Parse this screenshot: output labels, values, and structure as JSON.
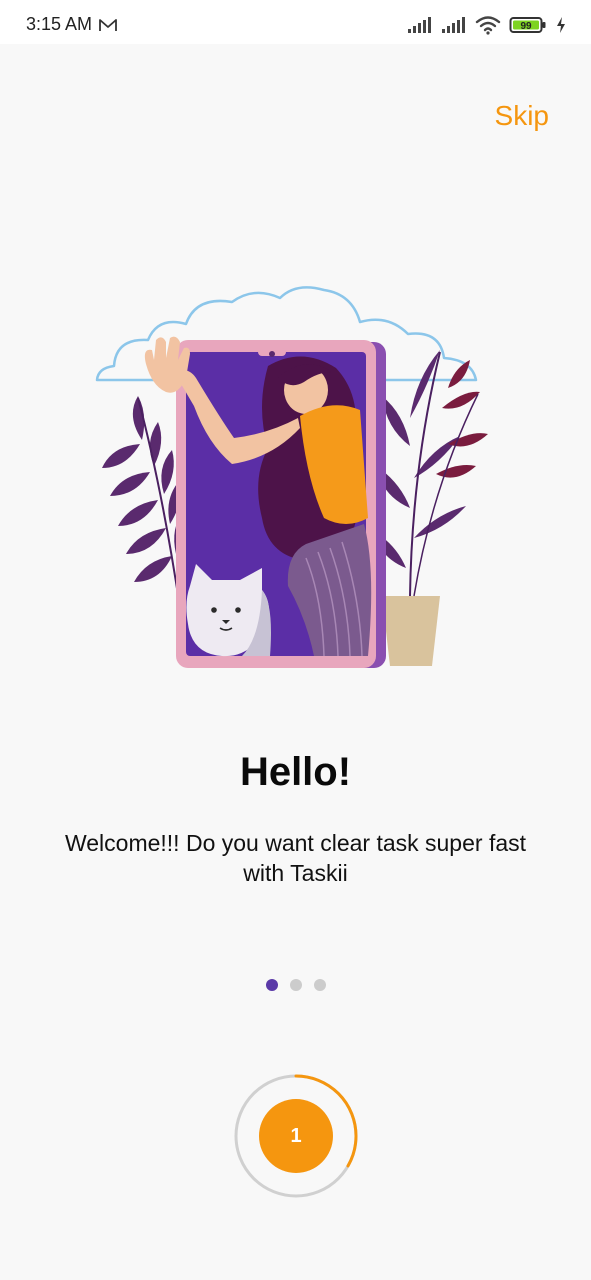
{
  "status_bar": {
    "time": "3:15 AM",
    "battery": "99",
    "icons": [
      "gmail-icon",
      "signal-icon",
      "signal-icon",
      "wifi-icon",
      "battery-icon",
      "charging-icon"
    ]
  },
  "onboarding": {
    "skip_label": "Skip",
    "title": "Hello!",
    "subtitle": "Welcome!!! Do you want clear task super fast with Taskii",
    "page_indicator": {
      "current": 1,
      "total": 3
    },
    "next_button_label": "1",
    "progress_fraction": 0.333
  },
  "colors": {
    "accent": "#f5960f",
    "indicator_active": "#5b3aa8",
    "indicator_inactive": "#cccccc",
    "background": "#f8f8f8"
  }
}
